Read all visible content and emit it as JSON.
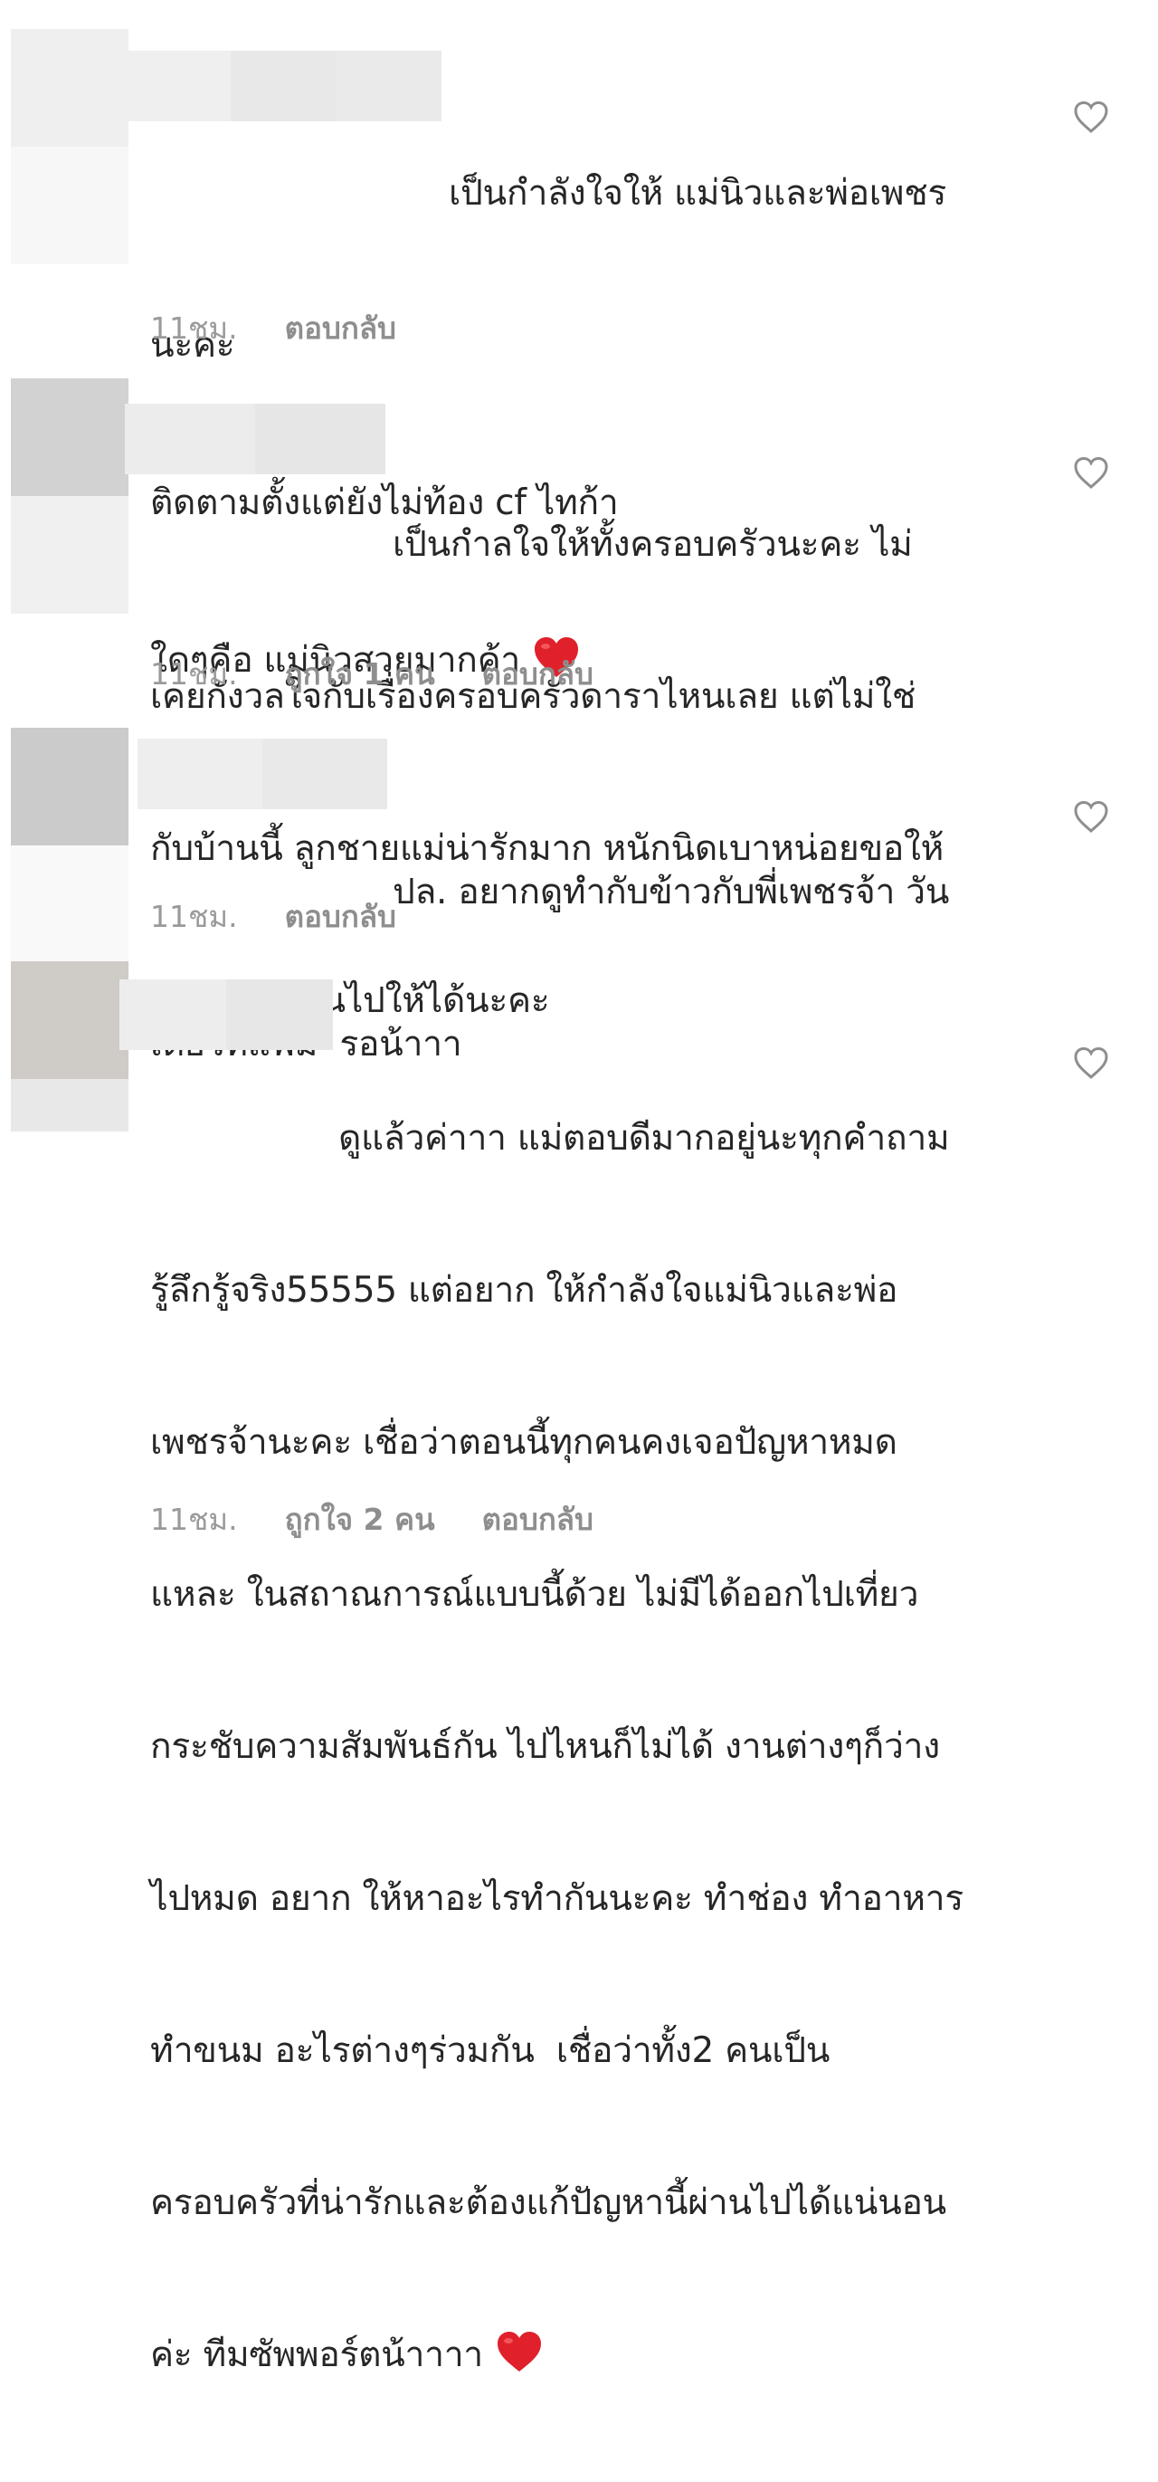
{
  "comments": [
    {
      "lines": [
        "เป็นกำลังใจให้ แม่นิวและพ่อเพชร",
        "นะคะ",
        "ติดตามตั้งแต่ยังไม่ท้อง cf ไทก้า",
        "ใดๆคือ แม่นิวสวยมากค้า"
      ],
      "emoji": "red-heart",
      "time": "11ชม.",
      "likes": "",
      "reply": "ตอบกลับ"
    },
    {
      "lines": [
        "เป็นกำลใจให้ทั้งครอบครัวนะคะ ไม่",
        "เคยกังวลใจกับเรื่องครอบครัวดาราไหนเลย แต่ไม่ใช่",
        "กับบ้านนี้ ลูกชายแม่น่ารักมาก หนักนิดเบาหน่อยขอให้",
        "จับมือกันผ่านไปให้ได้นะคะ"
      ],
      "emoji": "",
      "time": "11ชม.",
      "likes": "ถูกใจ 1 คน",
      "reply": "ตอบกลับ"
    },
    {
      "lines": [
        "ปล. อยากดูทำกับข้าวกับพี่เพชรจ้า วัน",
        "เดย์วิทแฟม  รอน้าาา"
      ],
      "emoji": "",
      "time": "11ชม.",
      "likes": "",
      "reply": "ตอบกลับ"
    },
    {
      "lines": [
        "ดูแล้วค่าาา แม่ตอบดีมากอยู่นะทุกคำถาม",
        "รู้ลึกรู้จริง55555 แต่อยาก ให้กำลังใจแม่นิวและพ่อ",
        "เพชรจ้านะคะ เชื่อว่าตอนนี้ทุกคนคงเจอปัญหาหมด",
        "แหละ ในสถาณการณ์แบบนี้ด้วย ไม่มีได้ออกไปเที่ยว",
        "กระชับความสัมพันธ์กัน ไปไหนก็ไม่ได้ งานต่างๆก็ว่าง",
        "ไปหมด อยาก ให้หาอะไรทำกันนะคะ ทำช่อง ทำอาหาร",
        "ทำขนม อะไรต่างๆร่วมกัน  เชื่อว่าทั้ง2 คนเป็น",
        "ครอบครัวที่น่ารักและต้องแก้ปัญหานี้ผ่านไปได้แน่นอน",
        "ค่ะ ทีมซัพพอร์ตน้าาาา"
      ],
      "emoji": "red-heart",
      "time": "11ชม.",
      "likes": "ถูกใจ 2 คน",
      "reply": "ตอบกลับ"
    }
  ],
  "colors": {
    "text": "#262626",
    "meta": "#8e8e8e",
    "heart_emoji": "#e0202a",
    "like_icon": "#8e8e8e"
  },
  "icons": {
    "like": "heart-outline-icon",
    "emoji": "red-heart-emoji-icon"
  }
}
